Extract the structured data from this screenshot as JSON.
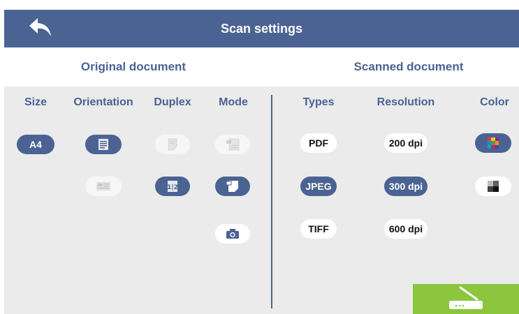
{
  "header": {
    "title": "Scan settings",
    "back_icon": "back-arrow-icon"
  },
  "sections": {
    "original_label": "Original document",
    "scanned_label": "Scanned document"
  },
  "columns": {
    "size": "Size",
    "orientation": "Orientation",
    "duplex": "Duplex",
    "mode": "Mode",
    "types": "Types",
    "resolution": "Resolution",
    "color": "Color"
  },
  "size_options": [
    "A4"
  ],
  "type_options": [
    "PDF",
    "JPEG",
    "TIFF"
  ],
  "resolution_options": [
    "200 dpi",
    "300 dpi",
    "600 dpi"
  ],
  "selected": {
    "size": "A4",
    "type": "JPEG",
    "resolution": "300 dpi",
    "color": "color",
    "orientation": "portrait",
    "duplex": "duplex",
    "mode": "document-feeder"
  },
  "icons": {
    "orientation": [
      "portrait-page-icon",
      "landscape-page-icon"
    ],
    "duplex": [
      "single-sided-icon",
      "double-sided-icon"
    ],
    "mode": [
      "document-feeder-icon",
      "flatbed-icon",
      "camera-icon"
    ],
    "color": [
      "color-palette-icon",
      "grayscale-icon"
    ],
    "scan": "scanner-icon"
  },
  "colors": {
    "primary": "#4a6393",
    "panel": "#ebebeb",
    "scan_button": "#8cc63f",
    "white": "#ffffff"
  }
}
